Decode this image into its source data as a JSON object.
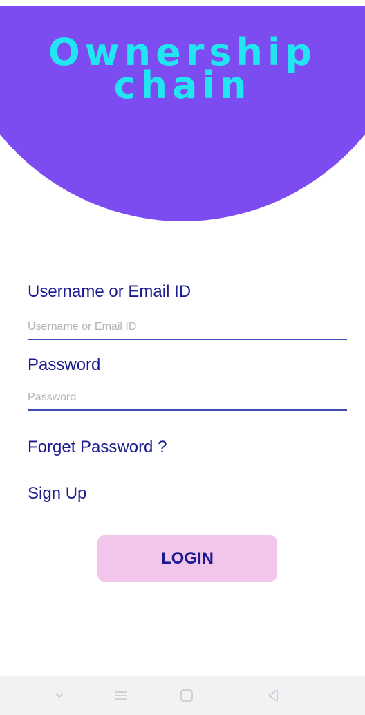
{
  "header": {
    "app_title": "Ownership\nchain",
    "background_color": "#7c4cf0",
    "title_color": "#22e5f2"
  },
  "form": {
    "username_label": "Username or Email ID",
    "username_placeholder": "Username or Email ID",
    "username_value": "",
    "password_label": "Password",
    "password_placeholder": "Password",
    "password_value": ""
  },
  "links": {
    "forget_password": "Forget Password ?",
    "sign_up": "Sign Up"
  },
  "login_button": {
    "label": "LOGIN",
    "color": "#f2c6ea"
  },
  "navbar": {
    "icons": [
      "chevron-down-icon",
      "menu-icon",
      "home-square-icon",
      "back-triangle-icon"
    ]
  }
}
